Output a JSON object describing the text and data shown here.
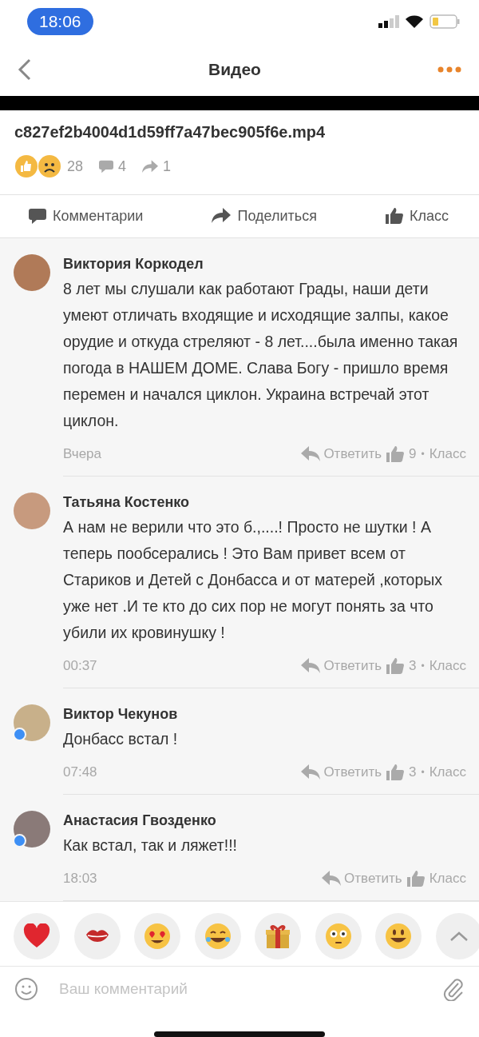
{
  "status_bar": {
    "time": "18:06"
  },
  "header": {
    "title": "Видео"
  },
  "video": {
    "title": "c827ef2b4004d1d59ff7a47bec905f6e.mp4",
    "reactions": "28",
    "comments": "4",
    "shares": "1"
  },
  "actions": [
    {
      "kind": "comment",
      "label": "Комментарии"
    },
    {
      "kind": "share",
      "label": "Поделиться"
    },
    {
      "kind": "like",
      "label": "Класс"
    }
  ],
  "comments": [
    {
      "author": "Виктория Коркодел",
      "online": false,
      "text": "8 лет мы слушали как работают Грады, наши дети умеют отличать входящие и исходящие залпы, какое орудие и откуда стреляют - 8 лет....была именно такая погода в НАШЕМ ДОМЕ. Слава Богу - пришло время перемен и начался циклон. Украина встречай этот циклон.",
      "time": "Вчера",
      "reply": "Ответить",
      "likes": "9",
      "separator": "•",
      "like_label": "Класс"
    },
    {
      "author": "Татьяна Костенко",
      "online": false,
      "text": "А нам не верили что это б.,....! Просто не шутки ! А теперь пообсерались ! Это Вам привет всем от Стариков и Детей с Донбасса и от матерей ,которых уже нет .И те кто до сих пор не могут понять за что убили их кровинушку !",
      "time": "00:37",
      "reply": "Ответить",
      "likes": "3",
      "separator": "•",
      "like_label": "Класс"
    },
    {
      "author": "Виктор Чекунов",
      "online": true,
      "text": "Донбасс встал !",
      "time": "07:48",
      "reply": "Ответить",
      "likes": "3",
      "separator": "•",
      "like_label": "Класс"
    },
    {
      "author": "Анастасия Гвозденко",
      "online": true,
      "text": "Как встал, так и ляжет!!!",
      "time": "18:03",
      "reply": "Ответить",
      "like_label": "Класс"
    }
  ],
  "quick_reactions": [
    {
      "kind": "heart"
    },
    {
      "kind": "kiss"
    },
    {
      "kind": "heart_eyes"
    },
    {
      "kind": "joy"
    },
    {
      "kind": "gift"
    },
    {
      "kind": "flushed"
    },
    {
      "kind": "smile"
    },
    {
      "kind": "expand"
    }
  ],
  "composer": {
    "placeholder": "Ваш комментарий"
  }
}
